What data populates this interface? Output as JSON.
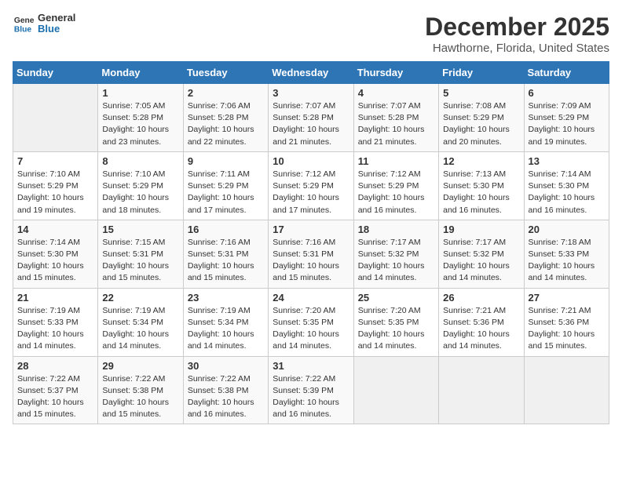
{
  "logo": {
    "line1": "General",
    "line2": "Blue"
  },
  "title": "December 2025",
  "location": "Hawthorne, Florida, United States",
  "days_of_week": [
    "Sunday",
    "Monday",
    "Tuesday",
    "Wednesday",
    "Thursday",
    "Friday",
    "Saturday"
  ],
  "weeks": [
    [
      {
        "day": "",
        "info": ""
      },
      {
        "day": "1",
        "info": "Sunrise: 7:05 AM\nSunset: 5:28 PM\nDaylight: 10 hours and 23 minutes."
      },
      {
        "day": "2",
        "info": "Sunrise: 7:06 AM\nSunset: 5:28 PM\nDaylight: 10 hours and 22 minutes."
      },
      {
        "day": "3",
        "info": "Sunrise: 7:07 AM\nSunset: 5:28 PM\nDaylight: 10 hours and 21 minutes."
      },
      {
        "day": "4",
        "info": "Sunrise: 7:07 AM\nSunset: 5:28 PM\nDaylight: 10 hours and 21 minutes."
      },
      {
        "day": "5",
        "info": "Sunrise: 7:08 AM\nSunset: 5:29 PM\nDaylight: 10 hours and 20 minutes."
      },
      {
        "day": "6",
        "info": "Sunrise: 7:09 AM\nSunset: 5:29 PM\nDaylight: 10 hours and 19 minutes."
      }
    ],
    [
      {
        "day": "7",
        "info": "Sunrise: 7:10 AM\nSunset: 5:29 PM\nDaylight: 10 hours and 19 minutes."
      },
      {
        "day": "8",
        "info": "Sunrise: 7:10 AM\nSunset: 5:29 PM\nDaylight: 10 hours and 18 minutes."
      },
      {
        "day": "9",
        "info": "Sunrise: 7:11 AM\nSunset: 5:29 PM\nDaylight: 10 hours and 17 minutes."
      },
      {
        "day": "10",
        "info": "Sunrise: 7:12 AM\nSunset: 5:29 PM\nDaylight: 10 hours and 17 minutes."
      },
      {
        "day": "11",
        "info": "Sunrise: 7:12 AM\nSunset: 5:29 PM\nDaylight: 10 hours and 16 minutes."
      },
      {
        "day": "12",
        "info": "Sunrise: 7:13 AM\nSunset: 5:30 PM\nDaylight: 10 hours and 16 minutes."
      },
      {
        "day": "13",
        "info": "Sunrise: 7:14 AM\nSunset: 5:30 PM\nDaylight: 10 hours and 16 minutes."
      }
    ],
    [
      {
        "day": "14",
        "info": "Sunrise: 7:14 AM\nSunset: 5:30 PM\nDaylight: 10 hours and 15 minutes."
      },
      {
        "day": "15",
        "info": "Sunrise: 7:15 AM\nSunset: 5:31 PM\nDaylight: 10 hours and 15 minutes."
      },
      {
        "day": "16",
        "info": "Sunrise: 7:16 AM\nSunset: 5:31 PM\nDaylight: 10 hours and 15 minutes."
      },
      {
        "day": "17",
        "info": "Sunrise: 7:16 AM\nSunset: 5:31 PM\nDaylight: 10 hours and 15 minutes."
      },
      {
        "day": "18",
        "info": "Sunrise: 7:17 AM\nSunset: 5:32 PM\nDaylight: 10 hours and 14 minutes."
      },
      {
        "day": "19",
        "info": "Sunrise: 7:17 AM\nSunset: 5:32 PM\nDaylight: 10 hours and 14 minutes."
      },
      {
        "day": "20",
        "info": "Sunrise: 7:18 AM\nSunset: 5:33 PM\nDaylight: 10 hours and 14 minutes."
      }
    ],
    [
      {
        "day": "21",
        "info": "Sunrise: 7:19 AM\nSunset: 5:33 PM\nDaylight: 10 hours and 14 minutes."
      },
      {
        "day": "22",
        "info": "Sunrise: 7:19 AM\nSunset: 5:34 PM\nDaylight: 10 hours and 14 minutes."
      },
      {
        "day": "23",
        "info": "Sunrise: 7:19 AM\nSunset: 5:34 PM\nDaylight: 10 hours and 14 minutes."
      },
      {
        "day": "24",
        "info": "Sunrise: 7:20 AM\nSunset: 5:35 PM\nDaylight: 10 hours and 14 minutes."
      },
      {
        "day": "25",
        "info": "Sunrise: 7:20 AM\nSunset: 5:35 PM\nDaylight: 10 hours and 14 minutes."
      },
      {
        "day": "26",
        "info": "Sunrise: 7:21 AM\nSunset: 5:36 PM\nDaylight: 10 hours and 14 minutes."
      },
      {
        "day": "27",
        "info": "Sunrise: 7:21 AM\nSunset: 5:36 PM\nDaylight: 10 hours and 15 minutes."
      }
    ],
    [
      {
        "day": "28",
        "info": "Sunrise: 7:22 AM\nSunset: 5:37 PM\nDaylight: 10 hours and 15 minutes."
      },
      {
        "day": "29",
        "info": "Sunrise: 7:22 AM\nSunset: 5:38 PM\nDaylight: 10 hours and 15 minutes."
      },
      {
        "day": "30",
        "info": "Sunrise: 7:22 AM\nSunset: 5:38 PM\nDaylight: 10 hours and 16 minutes."
      },
      {
        "day": "31",
        "info": "Sunrise: 7:22 AM\nSunset: 5:39 PM\nDaylight: 10 hours and 16 minutes."
      },
      {
        "day": "",
        "info": ""
      },
      {
        "day": "",
        "info": ""
      },
      {
        "day": "",
        "info": ""
      }
    ]
  ]
}
